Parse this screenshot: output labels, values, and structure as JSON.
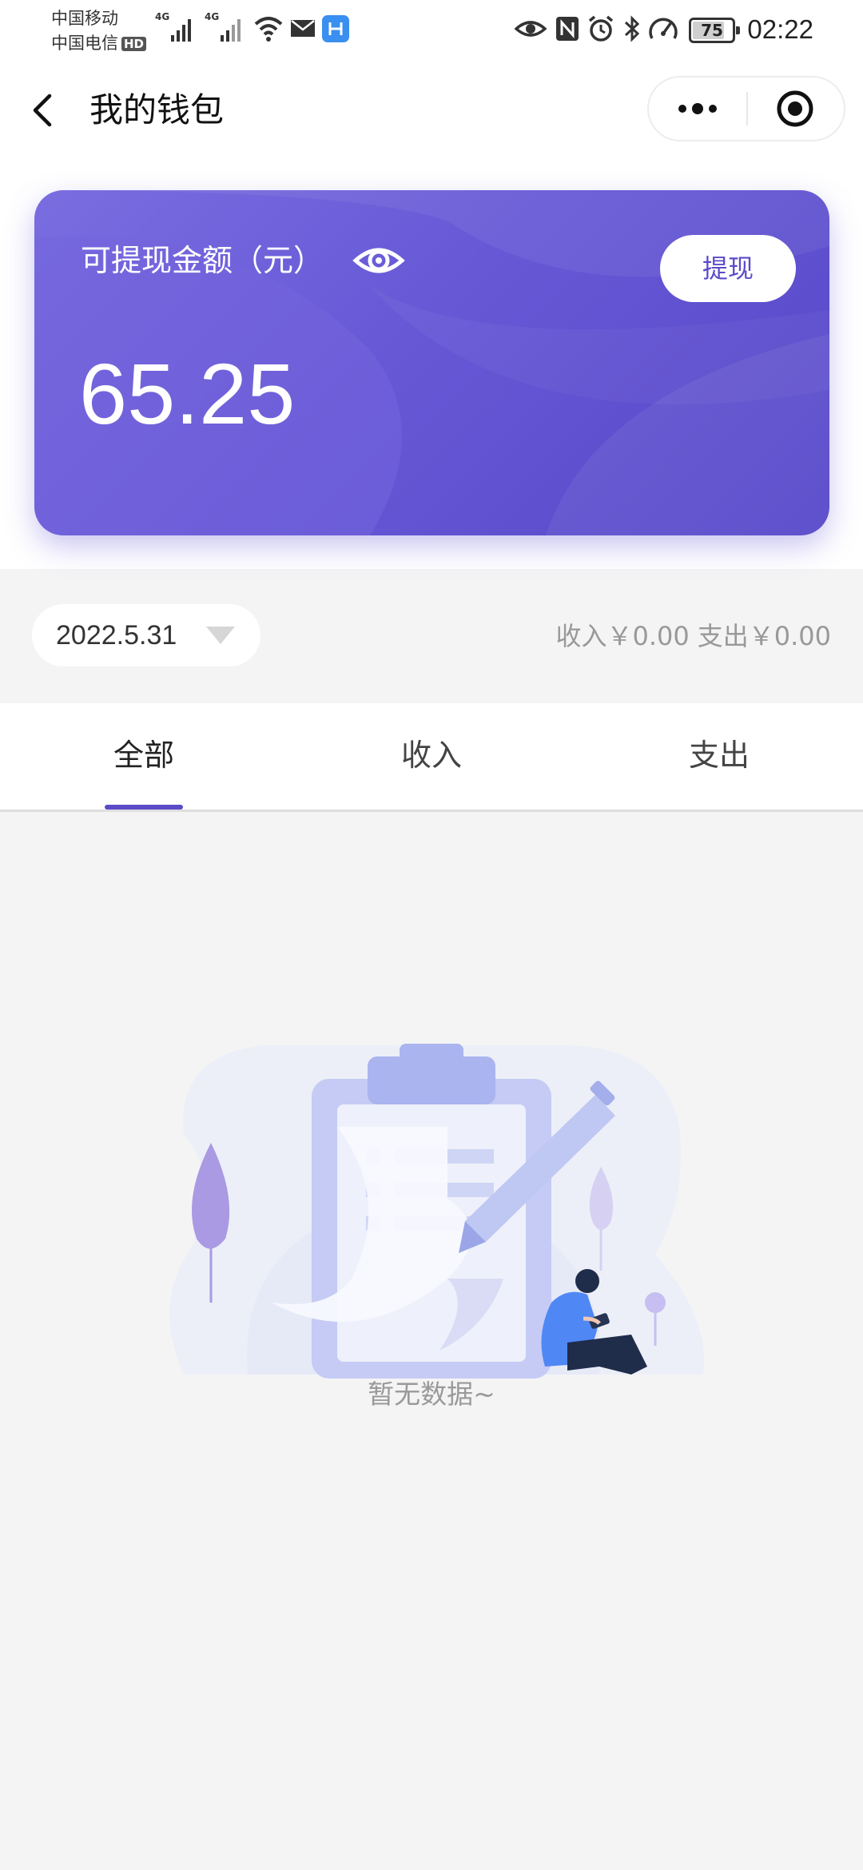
{
  "status_bar": {
    "carrier_1": "中国移动",
    "carrier_2": "中国电信",
    "hd_badge": "HD",
    "net_1": "4G",
    "net_2": "4G",
    "battery": "75",
    "time": "02:22"
  },
  "nav": {
    "title": "我的钱包"
  },
  "wallet": {
    "balance_label": "可提现金额（元）",
    "balance_value": "65.25",
    "withdraw_label": "提现"
  },
  "filter": {
    "date": "2022.5.31",
    "income_summary": "收入￥0.00",
    "expense_summary": "支出￥0.00"
  },
  "tabs": [
    {
      "label": "全部",
      "active": true
    },
    {
      "label": "收入",
      "active": false
    },
    {
      "label": "支出",
      "active": false
    }
  ],
  "empty_state": {
    "text": "暂无数据~"
  },
  "colors": {
    "accent": "#5a4bc8",
    "card_start": "#7a6de0",
    "card_end": "#5647c8",
    "page_bg": "#f4f4f5"
  }
}
